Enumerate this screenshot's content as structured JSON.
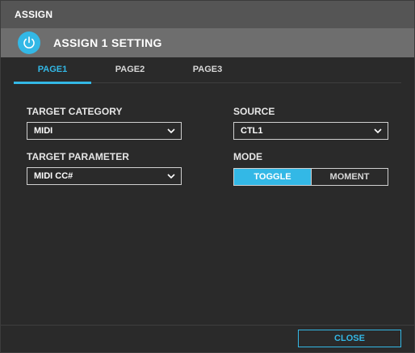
{
  "window": {
    "title": "ASSIGN"
  },
  "header": {
    "title": "ASSIGN 1 SETTING",
    "icon": "power-icon",
    "accent": "#33b8e6"
  },
  "tabs": [
    {
      "label": "PAGE1",
      "active": true
    },
    {
      "label": "PAGE2",
      "active": false
    },
    {
      "label": "PAGE3",
      "active": false
    }
  ],
  "target_category": {
    "label": "TARGET CATEGORY",
    "value": "MIDI"
  },
  "target_parameter": {
    "label": "TARGET PARAMETER",
    "value": "MIDI CC#"
  },
  "source": {
    "label": "SOURCE",
    "value": "CTL1"
  },
  "mode": {
    "label": "MODE",
    "options": [
      "TOGGLE",
      "MOMENT"
    ],
    "selected": "TOGGLE"
  },
  "footer": {
    "close_label": "CLOSE"
  }
}
